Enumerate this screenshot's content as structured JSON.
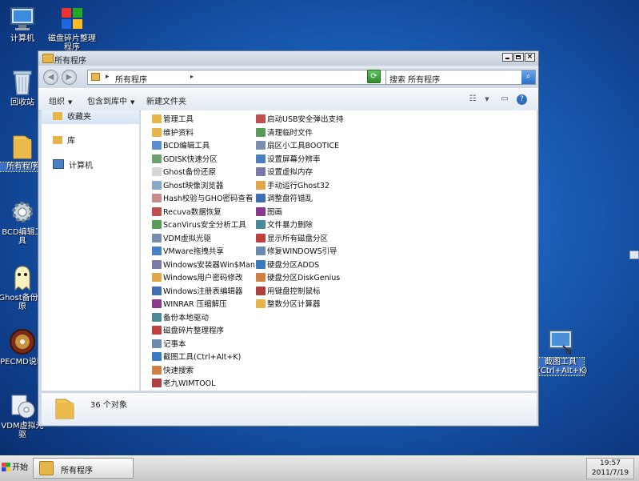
{
  "desktop_icons": [
    {
      "name": "computer",
      "label": "计算机"
    },
    {
      "name": "defrag",
      "label": "磁盘碎片整理程序"
    },
    {
      "name": "recycle-bin",
      "label": "回收站"
    },
    {
      "name": "all-programs",
      "label": "所有程序"
    },
    {
      "name": "bcd-edit",
      "label": "BCD编辑工具"
    },
    {
      "name": "ghost",
      "label": "Ghost备份还原"
    },
    {
      "name": "pecmd",
      "label": "PECMD说明"
    },
    {
      "name": "vdm",
      "label": "VDM虚拟光驱"
    },
    {
      "name": "screenshot",
      "label": "截图工具 (Ctrl+Alt+K)"
    }
  ],
  "window": {
    "title": "所有程序",
    "address_path": "所有程序",
    "search_placeholder": "搜索 所有程序",
    "toolbar": {
      "organize": "组织",
      "include": "包含到库中",
      "new_folder": "新建文件夹"
    },
    "nav": {
      "favorites": "收藏夹",
      "libraries": "库",
      "computer": "计算机"
    },
    "items_col1": [
      "管理工具",
      "维护资料",
      "BCD编辑工具",
      "GDISK快速分区",
      "Ghost备份还原",
      "Ghost映像浏览器",
      "Hash校验与GHO密码查看",
      "Recuva数据恢复",
      "ScanVirus安全分析工具",
      "VDM虚拟光驱",
      "VMware拖拽共享",
      "Windows安装器Win$Man",
      "Windows用户密码修改",
      "Windows注册表编辑器",
      "WINRAR 压缩解压",
      "备份本地驱动",
      "磁盘碎片整理程序",
      "记事本",
      "截图工具(Ctrl+Alt+K)",
      "快速搜索",
      "老九WIMTOOL"
    ],
    "items_col2": [
      "启动USB安全弹出支持",
      "清理临时文件",
      "扇区小工具BOOTICE",
      "设置屏幕分辨率",
      "设置虚拟内存",
      "手动运行Ghost32",
      "调整盘符错乱",
      "图画",
      "文件暴力删除",
      "显示所有磁盘分区",
      "修复WINDOWS引导",
      "硬盘分区ADDS",
      "硬盘分区DiskGenius",
      "用键盘控制鼠标",
      "整数分区计算器"
    ],
    "details": "36 个对象"
  },
  "taskbar": {
    "start": "开始",
    "task": "所有程序",
    "time": "19:57",
    "date": "2011/7/19"
  },
  "colors": {
    "folder": "#e7b64a",
    "desktop": "#1a5fb8",
    "selected": "#3a6fc4"
  }
}
